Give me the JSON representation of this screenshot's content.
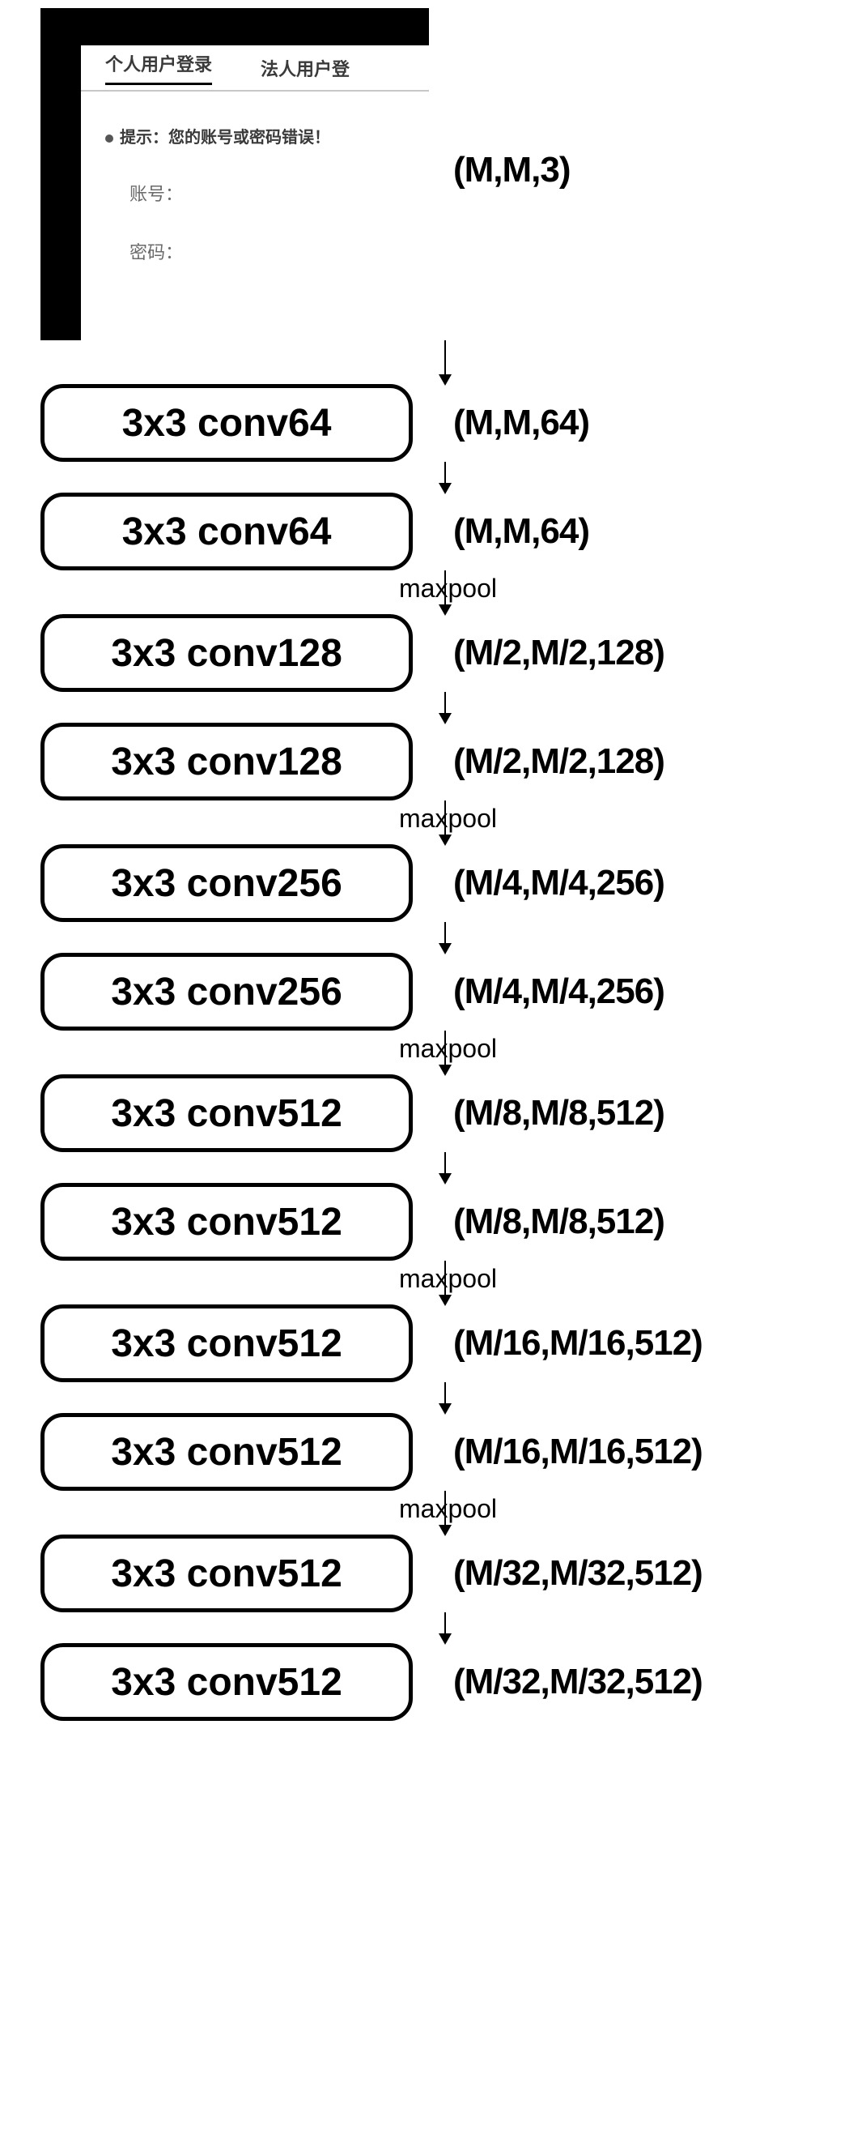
{
  "chart_data": {
    "type": "diagram-flow",
    "title": "CNN feature extractor (VGG-like) forward pass shapes",
    "input": {
      "label": "screenshot (login UI)",
      "shape": "(M,M,3)"
    },
    "layers": [
      {
        "name": "3x3 conv64",
        "output_shape": "(M,M,64)",
        "preceded_by": "input"
      },
      {
        "name": "3x3 conv64",
        "output_shape": "(M,M,64)",
        "preceded_by": "arrow"
      },
      {
        "name": "3x3 conv128",
        "output_shape": "(M/2,M/2,128)",
        "preceded_by": "maxpool"
      },
      {
        "name": "3x3 conv128",
        "output_shape": "(M/2,M/2,128)",
        "preceded_by": "arrow"
      },
      {
        "name": "3x3 conv256",
        "output_shape": "(M/4,M/4,256)",
        "preceded_by": "maxpool"
      },
      {
        "name": "3x3 conv256",
        "output_shape": "(M/4,M/4,256)",
        "preceded_by": "arrow"
      },
      {
        "name": "3x3 conv512",
        "output_shape": "(M/8,M/8,512)",
        "preceded_by": "maxpool"
      },
      {
        "name": "3x3 conv512",
        "output_shape": "(M/8,M/8,512)",
        "preceded_by": "arrow"
      },
      {
        "name": "3x3 conv512",
        "output_shape": "(M/16,M/16,512)",
        "preceded_by": "maxpool"
      },
      {
        "name": "3x3 conv512",
        "output_shape": "(M/16,M/16,512)",
        "preceded_by": "arrow"
      },
      {
        "name": "3x3 conv512",
        "output_shape": "(M/32,M/32,512)",
        "preceded_by": "maxpool"
      },
      {
        "name": "3x3 conv512",
        "output_shape": "(M/32,M/32,512)",
        "preceded_by": "arrow"
      }
    ],
    "pool_label": "maxpool"
  },
  "input_ui": {
    "tab_personal": "个人用户登录",
    "tab_corp": "法人用户登",
    "warning": "提示：您的账号或密码错误！",
    "line1": "账号：",
    "line2": "密码："
  },
  "shapes": {
    "input": "(M,M,3)",
    "l0": "(M,M,64)",
    "l1": "(M,M,64)",
    "l2": "(M/2,M/2,128)",
    "l3": "(M/2,M/2,128)",
    "l4": "(M/4,M/4,256)",
    "l5": "(M/4,M/4,256)",
    "l6": "(M/8,M/8,512)",
    "l7": "(M/8,M/8,512)",
    "l8": "(M/16,M/16,512)",
    "l9": "(M/16,M/16,512)",
    "l10": "(M/32,M/32,512)",
    "l11": "(M/32,M/32,512)"
  },
  "blocks": {
    "l0": "3x3 conv64",
    "l1": "3x3 conv64",
    "l2": "3x3 conv128",
    "l3": "3x3 conv128",
    "l4": "3x3 conv256",
    "l5": "3x3 conv256",
    "l6": "3x3 conv512",
    "l7": "3x3 conv512",
    "l8": "3x3 conv512",
    "l9": "3x3 conv512",
    "l10": "3x3 conv512",
    "l11": "3x3 conv512"
  },
  "pool_label": "maxpool"
}
